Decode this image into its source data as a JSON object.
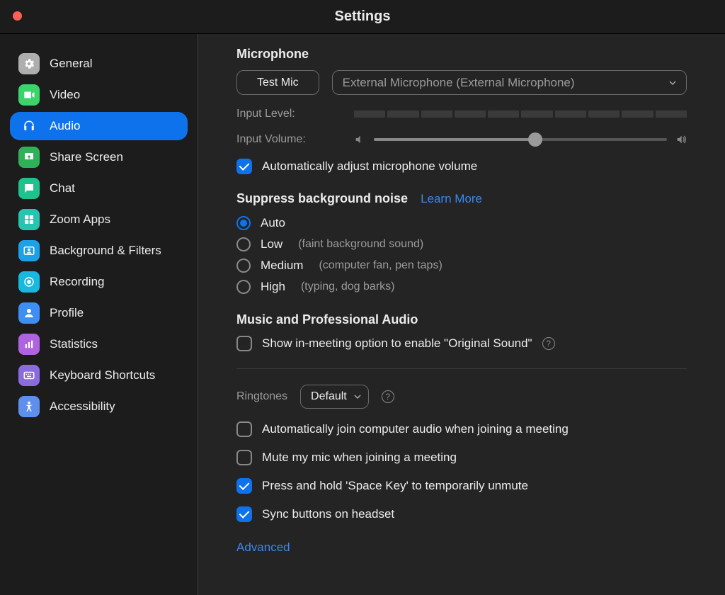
{
  "title": "Settings",
  "sidebar": {
    "items": [
      {
        "label": "General"
      },
      {
        "label": "Video"
      },
      {
        "label": "Audio"
      },
      {
        "label": "Share Screen"
      },
      {
        "label": "Chat"
      },
      {
        "label": "Zoom Apps"
      },
      {
        "label": "Background & Filters"
      },
      {
        "label": "Recording"
      },
      {
        "label": "Profile"
      },
      {
        "label": "Statistics"
      },
      {
        "label": "Keyboard Shortcuts"
      },
      {
        "label": "Accessibility"
      }
    ]
  },
  "mic": {
    "heading": "Microphone",
    "test_btn": "Test Mic",
    "device": "External Microphone (External Microphone)",
    "input_level_label": "Input Level:",
    "input_volume_label": "Input Volume:",
    "auto_adjust": "Automatically adjust microphone volume"
  },
  "noise": {
    "heading": "Suppress background noise",
    "learn": "Learn More",
    "options": [
      {
        "label": "Auto",
        "hint": ""
      },
      {
        "label": "Low",
        "hint": "(faint background sound)"
      },
      {
        "label": "Medium",
        "hint": "(computer fan, pen taps)"
      },
      {
        "label": "High",
        "hint": "(typing, dog barks)"
      }
    ]
  },
  "music": {
    "heading": "Music and Professional Audio",
    "original": "Show in-meeting option to enable \"Original Sound\""
  },
  "ringtones": {
    "label": "Ringtones",
    "value": "Default"
  },
  "opts": {
    "auto_join": "Automatically join computer audio when joining a meeting",
    "mute_join": "Mute my mic when joining a meeting",
    "space_unmute": "Press and hold 'Space Key' to temporarily unmute",
    "sync_headset": "Sync buttons on headset"
  },
  "advanced": "Advanced",
  "slider": {
    "percent": 55
  }
}
